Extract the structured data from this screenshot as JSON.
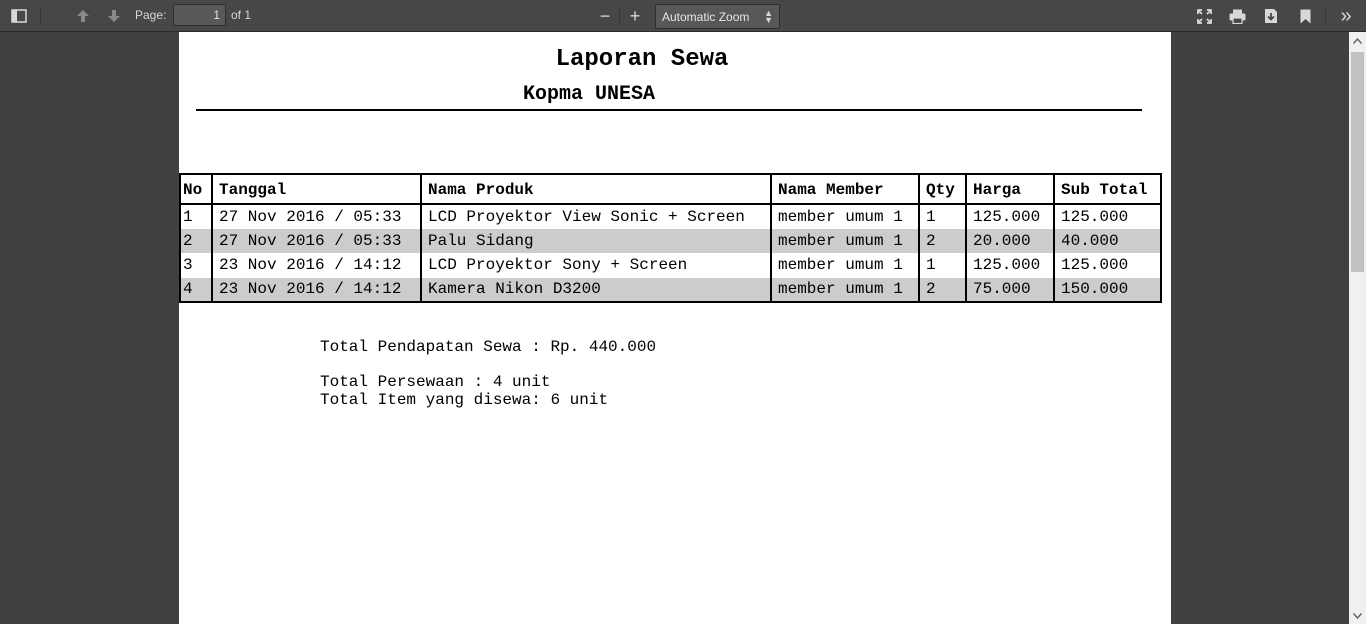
{
  "toolbar": {
    "page_label": "Page:",
    "page_value": "1",
    "page_of": "of 1",
    "zoom_value": "Automatic Zoom",
    "icons": {
      "sidebar": "sidebar-toggle-icon",
      "prev": "arrow-up-icon",
      "next": "arrow-down-icon",
      "zoom_out": "minus-icon",
      "zoom_in": "plus-icon",
      "presentation": "fullscreen-icon",
      "print": "printer-icon",
      "download": "download-icon",
      "bookmark": "bookmark-icon",
      "tools": "double-chevron-right-icon"
    },
    "glyphs": {
      "minus": "−",
      "plus": "+",
      "tools": "»",
      "caret_up": "▲",
      "caret_down": "▼"
    }
  },
  "document": {
    "title": "Laporan Sewa",
    "subtitle": "Kopma UNESA",
    "table": {
      "headers": [
        "No",
        "Tanggal",
        "Nama Produk",
        "Nama Member",
        "Qty",
        "Harga",
        "Sub Total"
      ],
      "rows": [
        [
          "1",
          "27 Nov 2016 / 05:33",
          "LCD Proyektor View Sonic + Screen",
          "member umum 1",
          "1",
          "125.000",
          "125.000"
        ],
        [
          "2",
          "27 Nov 2016 / 05:33",
          "Palu Sidang",
          "member umum 1",
          "2",
          "20.000",
          "40.000"
        ],
        [
          "3",
          "23 Nov 2016 / 14:12",
          "LCD Proyektor Sony + Screen",
          "member umum 1",
          "1",
          "125.000",
          "125.000"
        ],
        [
          "4",
          "23 Nov 2016 / 14:12",
          "Kamera Nikon D3200",
          "member umum 1",
          "2",
          "75.000",
          "150.000"
        ]
      ]
    },
    "summary": {
      "pendapatan": "Total Pendapatan Sewa : Rp. 440.000",
      "persewaan": "Total Persewaan : 4 unit",
      "item": "Total Item yang disewa: 6 unit"
    }
  },
  "colors": {
    "toolbar": "#474747",
    "viewer_bg": "#404040",
    "row_alt": "#cccccc"
  }
}
